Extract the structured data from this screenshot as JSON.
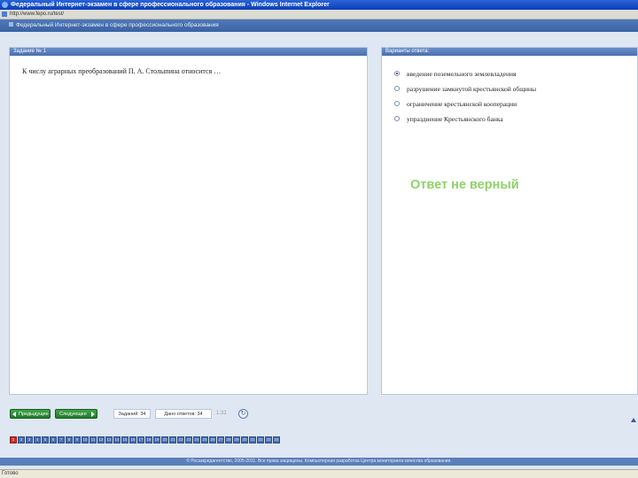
{
  "window": {
    "title": "Федеральный Интернет-экзамен в сфере профессионального образования - Windows Internet Explorer"
  },
  "address": {
    "url": "http://www.fepo.ru/test/"
  },
  "app": {
    "header": "Федеральный Интернет-экзамен в сфере профессионального образования"
  },
  "question": {
    "panel_title": "Задание № 1",
    "text": "К числу аграрных преобразований П. А. Столыпина относится …"
  },
  "answers": {
    "panel_title": "Варианты ответа:",
    "options": [
      {
        "label": "введение поземельного землевладения",
        "checked": true
      },
      {
        "label": "разрушение замкнутой крестьянской общины",
        "checked": false
      },
      {
        "label": "ограничение крестьянской кооперации",
        "checked": false
      },
      {
        "label": "упразднение Крестьянского банка",
        "checked": false
      }
    ],
    "result": "Ответ не верный"
  },
  "nav": {
    "prev_label": "Предыдущее",
    "next_label": "Следующее",
    "total_label": "Заданий: 34",
    "answered_label": "Дано ответов: 34",
    "timer": "1:31",
    "refresh_icon": "refresh-icon"
  },
  "questions": [
    "1",
    "2",
    "3",
    "4",
    "5",
    "6",
    "7",
    "8",
    "9",
    "10",
    "11",
    "12",
    "13",
    "14",
    "15",
    "16",
    "17",
    "18",
    "19",
    "20",
    "21",
    "22",
    "23",
    "24",
    "25",
    "26",
    "27",
    "28",
    "29",
    "30",
    "31",
    "32",
    "33",
    "34"
  ],
  "footer": {
    "text": "© Росаккредагентство, 2005-2011. Все права защищены. Компьютерная разработка Центра мониторинга качества образования."
  },
  "status": {
    "text": "Готово"
  }
}
